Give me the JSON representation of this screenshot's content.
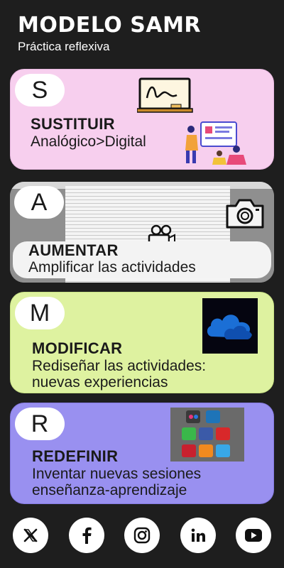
{
  "header": {
    "title": "MODELO SAMR",
    "subtitle": "Práctica reflexiva"
  },
  "cards": [
    {
      "letter": "S",
      "title": "SUSTITUIR",
      "description": "Analógico>Digital",
      "color": "#f7cfee",
      "icons": [
        "whiteboard-icon",
        "presentation-illustration"
      ]
    },
    {
      "letter": "A",
      "title": "AUMENTAR",
      "description": "Amplificar las actividades",
      "color": "#9c9c9c",
      "icons": [
        "camera-icon",
        "film-camera-icon"
      ]
    },
    {
      "letter": "M",
      "title": "MODIFICAR",
      "description_line1": "Rediseñar las actividades:",
      "description_line2": "nuevas experiencias",
      "color": "#def2a0",
      "icons": [
        "onedrive-cloud-icon"
      ]
    },
    {
      "letter": "R",
      "title": "REDEFINIR",
      "description_line1": "Inventar nuevas sesiones",
      "description_line2": "enseñanza-aprendizaje",
      "color": "#9990f0",
      "icons": [
        "social-media-cubes-icon"
      ]
    }
  ],
  "social": [
    "x-icon",
    "facebook-icon",
    "instagram-icon",
    "linkedin-icon",
    "youtube-icon"
  ]
}
